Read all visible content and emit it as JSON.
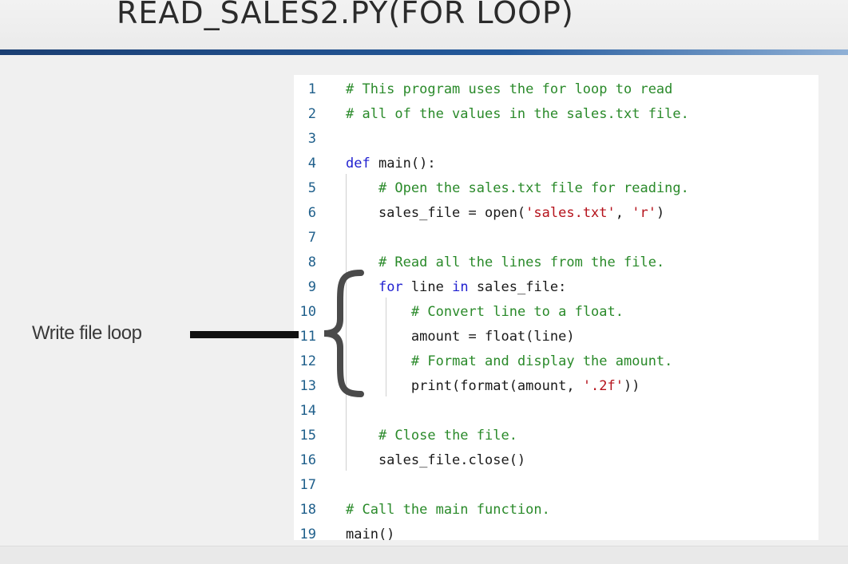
{
  "slide": {
    "title": "READ_SALES2.PY(FOR LOOP)",
    "annotation_label": "Write file loop",
    "colors": {
      "comment": "#2a8a2a",
      "keyword": "#1f1fd0",
      "string": "#b5121b",
      "line_number": "#1f5f8b",
      "rule": "#245a9c"
    }
  },
  "code": {
    "lines": [
      {
        "num": "1",
        "tokens": [
          {
            "t": "# This program uses the for loop to read",
            "k": "comment"
          }
        ]
      },
      {
        "num": "2",
        "tokens": [
          {
            "t": "# all of the values in the sales.txt file.",
            "k": "comment"
          }
        ]
      },
      {
        "num": "3",
        "tokens": []
      },
      {
        "num": "4",
        "tokens": [
          {
            "t": "def",
            "k": "keyword"
          },
          {
            "t": " main():",
            "k": "plain"
          }
        ]
      },
      {
        "num": "5",
        "tokens": [
          {
            "t": "    ",
            "k": "plain"
          },
          {
            "t": "# Open the sales.txt file for reading.",
            "k": "comment"
          }
        ]
      },
      {
        "num": "6",
        "tokens": [
          {
            "t": "    sales_file = open(",
            "k": "plain"
          },
          {
            "t": "'sales.txt'",
            "k": "string"
          },
          {
            "t": ", ",
            "k": "plain"
          },
          {
            "t": "'r'",
            "k": "string"
          },
          {
            "t": ")",
            "k": "plain"
          }
        ]
      },
      {
        "num": "7",
        "tokens": []
      },
      {
        "num": "8",
        "tokens": [
          {
            "t": "    ",
            "k": "plain"
          },
          {
            "t": "# Read all the lines from the file.",
            "k": "comment"
          }
        ]
      },
      {
        "num": "9",
        "tokens": [
          {
            "t": "    ",
            "k": "plain"
          },
          {
            "t": "for",
            "k": "keyword"
          },
          {
            "t": " line ",
            "k": "plain"
          },
          {
            "t": "in",
            "k": "keyword"
          },
          {
            "t": " sales_file:",
            "k": "plain"
          }
        ]
      },
      {
        "num": "10",
        "tokens": [
          {
            "t": "        ",
            "k": "plain"
          },
          {
            "t": "# Convert line to a float.",
            "k": "comment"
          }
        ]
      },
      {
        "num": "11",
        "tokens": [
          {
            "t": "        amount = float(line)",
            "k": "plain"
          }
        ]
      },
      {
        "num": "12",
        "tokens": [
          {
            "t": "        ",
            "k": "plain"
          },
          {
            "t": "# Format and display the amount.",
            "k": "comment"
          }
        ]
      },
      {
        "num": "13",
        "tokens": [
          {
            "t": "        print(format(amount, ",
            "k": "plain"
          },
          {
            "t": "'.2f'",
            "k": "string"
          },
          {
            "t": "))",
            "k": "plain"
          }
        ]
      },
      {
        "num": "14",
        "tokens": []
      },
      {
        "num": "15",
        "tokens": [
          {
            "t": "    ",
            "k": "plain"
          },
          {
            "t": "# Close the file.",
            "k": "comment"
          }
        ]
      },
      {
        "num": "16",
        "tokens": [
          {
            "t": "    sales_file.close()",
            "k": "plain"
          }
        ]
      },
      {
        "num": "17",
        "tokens": []
      },
      {
        "num": "18",
        "tokens": [
          {
            "t": "# Call the main function.",
            "k": "comment"
          }
        ]
      },
      {
        "num": "19",
        "tokens": [
          {
            "t": "main()",
            "k": "plain"
          }
        ]
      }
    ]
  }
}
